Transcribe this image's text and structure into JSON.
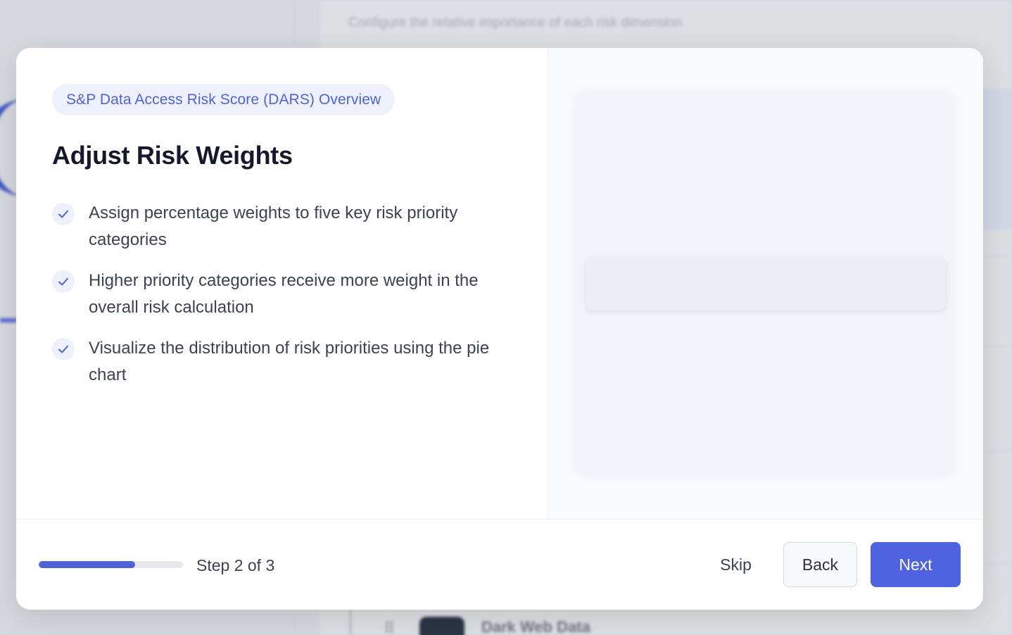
{
  "background": {
    "subtitle": "Configure the relative importance of each risk dimension",
    "bottom_row_title": "Dark Web Data"
  },
  "modal": {
    "badge": "S&P Data Access Risk Score (DARS) Overview",
    "title": "Adjust Risk Weights",
    "bullets": [
      "Assign percentage weights to five key risk priority categories",
      "Higher priority categories receive more weight in the overall risk calculation",
      "Visualize the distribution of risk priorities using the pie chart"
    ]
  },
  "footer": {
    "step_label": "Step 2 of 3",
    "progress_fraction": 0.667,
    "skip_label": "Skip",
    "back_label": "Back",
    "next_label": "Next"
  },
  "colors": {
    "accent": "#4f63e0",
    "badge_bg": "#eef0fb",
    "title_text": "#141a2b"
  },
  "icons": {
    "bullet": "check-icon",
    "drag_handle": "drag-dots-icon"
  }
}
